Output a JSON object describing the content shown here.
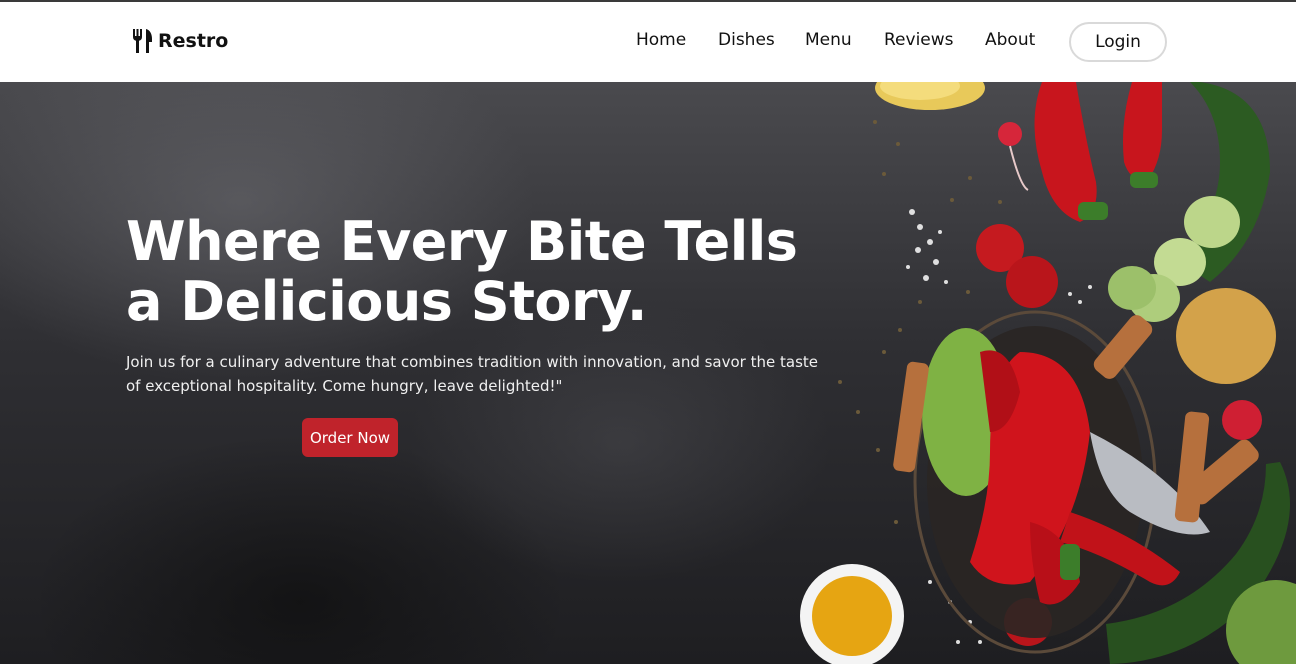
{
  "brand": {
    "name": "Restro",
    "icon": "fork-knife-icon"
  },
  "nav": {
    "items": [
      {
        "label": "Home"
      },
      {
        "label": "Dishes"
      },
      {
        "label": "Menu"
      },
      {
        "label": "Reviews"
      },
      {
        "label": "About"
      }
    ],
    "login_label": "Login"
  },
  "hero": {
    "title": "Where Every Bite Tells a Delicious Story.",
    "subtitle": "Join us for a culinary adventure that combines tradition with innovation, and savor the taste of exceptional hospitality. Come hungry, leave delighted!\"",
    "cta_label": "Order Now"
  },
  "colors": {
    "accent": "#c0232b",
    "nav_bg": "#ffffff",
    "hero_bg": "#2f2f33",
    "text_light": "#ffffff"
  }
}
